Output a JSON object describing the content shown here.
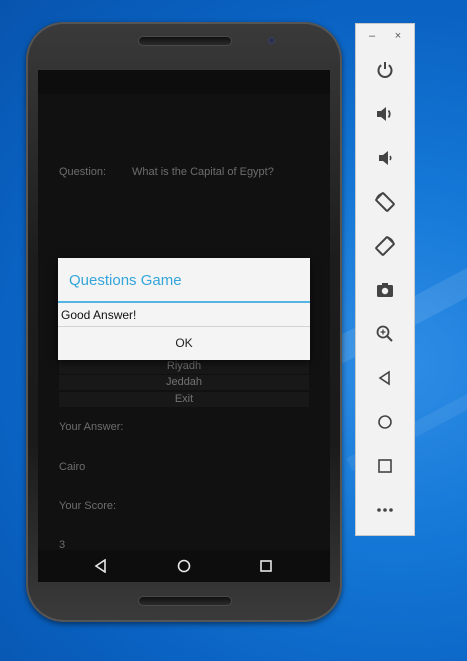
{
  "app": {
    "question_label": "Question:",
    "question_text": "What is the Capital of Egypt?",
    "options": [
      "Riyadh",
      "Jeddah",
      "Exit"
    ],
    "answer_label": "Your Answer:",
    "answer_value": "Cairo",
    "score_label": "Your Score:",
    "score_value": "3"
  },
  "dialog": {
    "title": "Questions Game",
    "message": "Good Answer!",
    "ok_label": "OK",
    "accent_color": "#33a5db"
  },
  "navbar": {
    "icons": [
      "back-icon",
      "home-icon",
      "recent-apps-icon"
    ]
  },
  "emulator_panel": {
    "minimize_label": "–",
    "close_label": "×",
    "tools": [
      "power-icon",
      "volume-up-icon",
      "volume-down-icon",
      "rotate-left-icon",
      "rotate-right-icon",
      "camera-icon",
      "zoom-icon",
      "back-icon",
      "home-icon",
      "overview-icon",
      "more-icon"
    ]
  }
}
